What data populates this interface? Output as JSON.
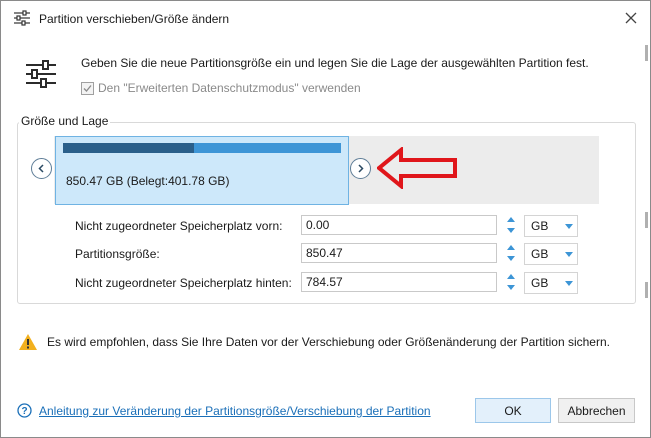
{
  "window": {
    "title": "Partition verschieben/Größe ändern",
    "title_icon": "sliders-icon",
    "close_icon": "close-icon"
  },
  "header": {
    "icon": "sliders-icon",
    "instruction": "Geben Sie die neue Partitionsgröße ein und legen Sie die Lage der ausgewählten Partition fest.",
    "privacy_checkbox_label": "Den \"Erweiterten Datenschutzmodus\" verwenden",
    "privacy_checked": true
  },
  "group": {
    "legend": "Größe und Lage",
    "partition": {
      "label": "850.47 GB (Belegt:401.78 GB)",
      "used_fraction": 0.4724
    },
    "fields": [
      {
        "label": "Nicht zugeordneter Speicherplatz vorn:",
        "value": "0.00",
        "unit": "GB"
      },
      {
        "label": "Partitionsgröße:",
        "value": "850.47",
        "unit": "GB"
      },
      {
        "label": "Nicht zugeordneter Speicherplatz hinten:",
        "value": "784.57",
        "unit": "GB"
      }
    ]
  },
  "warning": {
    "icon": "warning-icon",
    "text": "Es wird empfohlen, dass Sie Ihre Daten vor der Verschiebung oder Größenänderung der Partition sichern."
  },
  "footer": {
    "help_icon": "help-icon",
    "help_link": "Anleitung zur Veränderung der Partitionsgröße/Verschiebung der Partition",
    "ok_label": "OK",
    "cancel_label": "Abbrechen"
  },
  "colors": {
    "partition_fill": "#cde8fa",
    "partition_border": "#6fb3e3",
    "used_bar": "#2a5f8a",
    "free_bar": "#3d95d6",
    "arrow": "#e0161b",
    "link": "#1a6fb8",
    "warning": "#f2b01e"
  }
}
